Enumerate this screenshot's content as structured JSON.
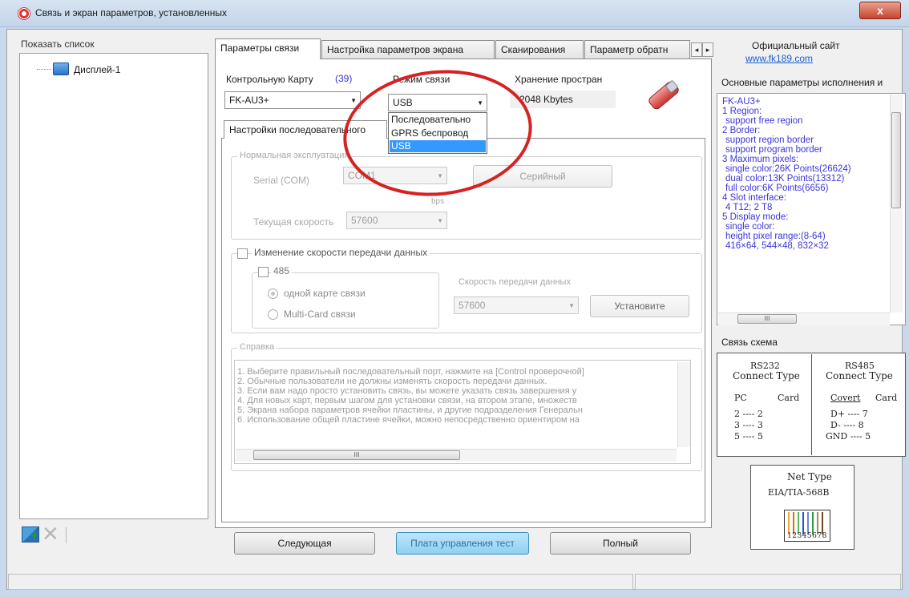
{
  "window": {
    "title": "Связь и экран параметров, установленных",
    "close_label": "x"
  },
  "left": {
    "list_label": "Показать список",
    "tree_item": "Дисплей-1"
  },
  "tabs": [
    {
      "label": "Параметры связи",
      "active": true
    },
    {
      "label": "Настройка параметров экрана"
    },
    {
      "label": "Сканирования"
    },
    {
      "label": "Параметр обратн"
    }
  ],
  "connection": {
    "card_label": "Контрольную Карту",
    "card_count": "(39)",
    "card_value": "FK-AU3+",
    "mode_label": "Режим связи",
    "mode_value": "USB",
    "storage_label": "Хранение простран",
    "storage_value": "2048 Kbytes",
    "mode_options": [
      "Последовательно",
      "GPRS беспровод",
      "USB"
    ],
    "selected_option": "USB"
  },
  "serial": {
    "subtab_label": "Настройки последовательного",
    "group_caption": "Нормальная эксплуатация",
    "port_label": "Serial (COM)",
    "port_value": "COM1",
    "serial_button": "Серийный",
    "bps_label": "bps",
    "speed_label": "Текущая скорость",
    "speed_value": "57600"
  },
  "rate_change": {
    "checkbox_label": "Изменение скорости передачи данных",
    "rs485_label": "485",
    "radio_single": "одной карте связи",
    "radio_multi": "Multi-Card связи",
    "rate_caption": "Скорость передачи данных",
    "rate_value": "57600",
    "set_button": "Установите"
  },
  "help": {
    "caption": "Справка",
    "lines": [
      "1. Выберите правильный последовательный порт, нажмите на [Control проверочной]",
      "2. Обычные пользователи не должны изменять скорость передачи данных.",
      "3. Если вам надо просто установить связь, вы можете указать связь завершения у",
      "4. Для новых карт, первым шагом для установки связи, на втором этапе, множеств",
      "5. Экрана набора параметров ячейки пластины, и другие подразделения Генеральн",
      "6. Использование общей пластине ячейки, можно непосредственно ориентиром на"
    ]
  },
  "buttons": {
    "next": "Следующая",
    "test": "Плата управления тест",
    "full": "Полный"
  },
  "right": {
    "site_label": "Официальный сайт",
    "site_url": "www.fk189.com",
    "params_label": "Основные параметры исполнения и",
    "params_lines": [
      "FK-AU3+",
      "1 Region:",
      "  support free region",
      "2 Border:",
      "  support region border",
      "  support program border",
      "3 Maximum pixels:",
      "  single color:26K Points(26624)",
      "  dual color:13K Points(13312)",
      "  full color:6K Points(6656)",
      "4 Slot interface:",
      "  4 T12; 2 T8",
      "5 Display mode:",
      "  single color:",
      "  height pixel range:(8-64)",
      "  416×64, 544×48, 832×32"
    ],
    "scheme_label": "Связь схема",
    "rs232": {
      "title1": "RS232",
      "title2": "Connect Type",
      "col1": "PC",
      "col2": "Card",
      "rows": [
        "2 ---- 2",
        "3 ---- 3",
        "5 ---- 5"
      ]
    },
    "rs485": {
      "title1": "RS485",
      "title2": "Connect Type",
      "col1": "Covert",
      "col2": "Card",
      "rows": [
        "D+ ---- 7",
        "D- ---- 8",
        "GND ---- 5"
      ]
    },
    "net": {
      "title": "Net Type",
      "standard": "EIA/TIA-568B",
      "pins": "12345678"
    }
  }
}
